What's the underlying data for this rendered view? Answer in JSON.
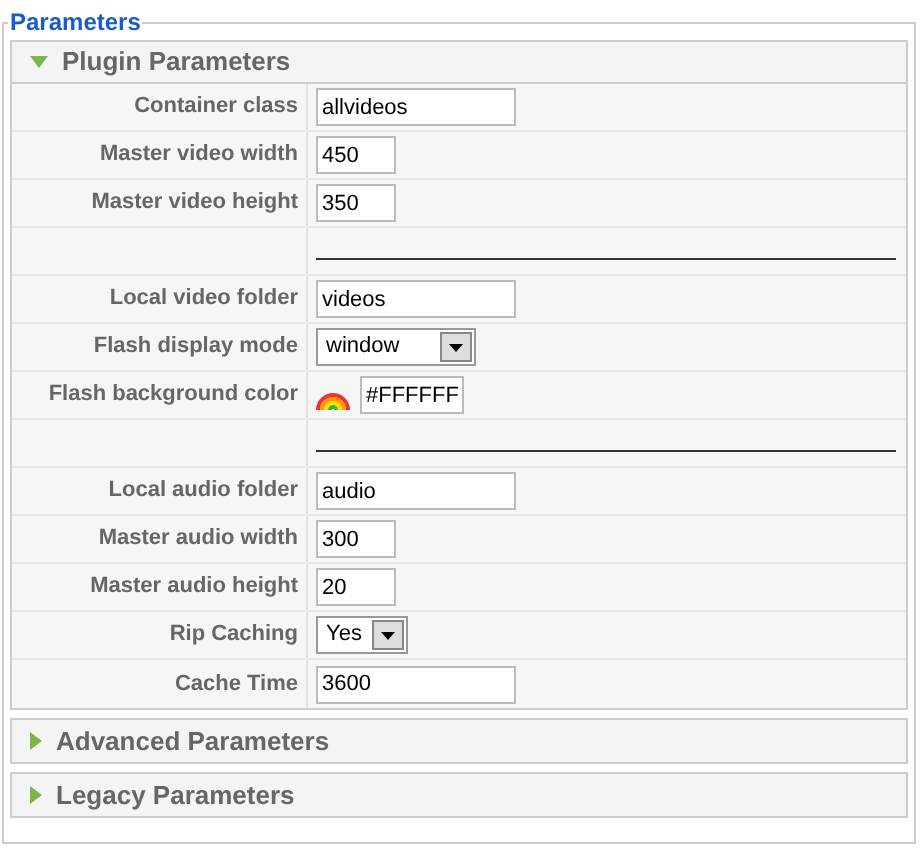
{
  "legend": "Parameters",
  "panels": [
    {
      "title": "Plugin Parameters",
      "expanded": true,
      "rows": [
        {
          "kind": "text",
          "label": "Container class",
          "value": "allvideos"
        },
        {
          "kind": "short_text",
          "label": "Master video width",
          "value": "450"
        },
        {
          "kind": "short_text",
          "label": "Master video height",
          "value": "350"
        },
        {
          "kind": "separator"
        },
        {
          "kind": "text",
          "label": "Local video folder",
          "value": "videos"
        },
        {
          "kind": "select",
          "label": "Flash display mode",
          "value": "window"
        },
        {
          "kind": "color",
          "label": "Flash background color",
          "value": "#FFFFFF"
        },
        {
          "kind": "separator"
        },
        {
          "kind": "text",
          "label": "Local audio folder",
          "value": "audio"
        },
        {
          "kind": "short_text",
          "label": "Master audio width",
          "value": "300"
        },
        {
          "kind": "short_text",
          "label": "Master audio height",
          "value": "20"
        },
        {
          "kind": "short_select",
          "label": "Rip Caching",
          "value": "Yes"
        },
        {
          "kind": "text",
          "label": "Cache Time",
          "value": "3600"
        }
      ]
    },
    {
      "title": "Advanced Parameters",
      "expanded": false
    },
    {
      "title": "Legacy Parameters",
      "expanded": false
    }
  ]
}
